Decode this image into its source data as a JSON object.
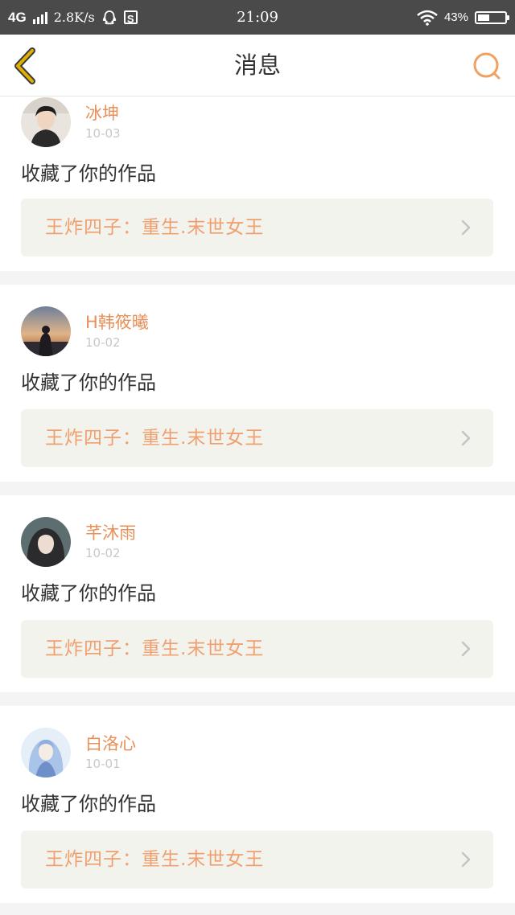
{
  "status_bar": {
    "network": "4G",
    "speed": "2.8K/s",
    "time": "21:09",
    "battery": "43%",
    "battery_level": 0.43,
    "icons": [
      "signal-icon",
      "qq-icon",
      "s-app-icon",
      "wifi-icon",
      "battery-icon"
    ]
  },
  "header": {
    "title": "消息",
    "back_icon": "chevron-left-icon",
    "search_icon": "search-icon"
  },
  "colors": {
    "accent": "#e8905a",
    "work_title": "#f0a070",
    "back_icon": "#e0b000",
    "search_icon": "#f0a060",
    "link_bg": "#f3f3ee",
    "page_bg": "#f4f4f4"
  },
  "messages": [
    {
      "username": "冰坤",
      "date": "10-03",
      "action": "收藏了你的作品",
      "work_title": "王炸四子：重生.末世女王"
    },
    {
      "username": "H韩筱曦",
      "date": "10-02",
      "action": "收藏了你的作品",
      "work_title": "王炸四子：重生.末世女王"
    },
    {
      "username": "芊沐雨",
      "date": "10-02",
      "action": "收藏了你的作品",
      "work_title": "王炸四子：重生.末世女王"
    },
    {
      "username": "白洛心",
      "date": "10-01",
      "action": "收藏了你的作品",
      "work_title": "王炸四子：重生.末世女王"
    }
  ]
}
